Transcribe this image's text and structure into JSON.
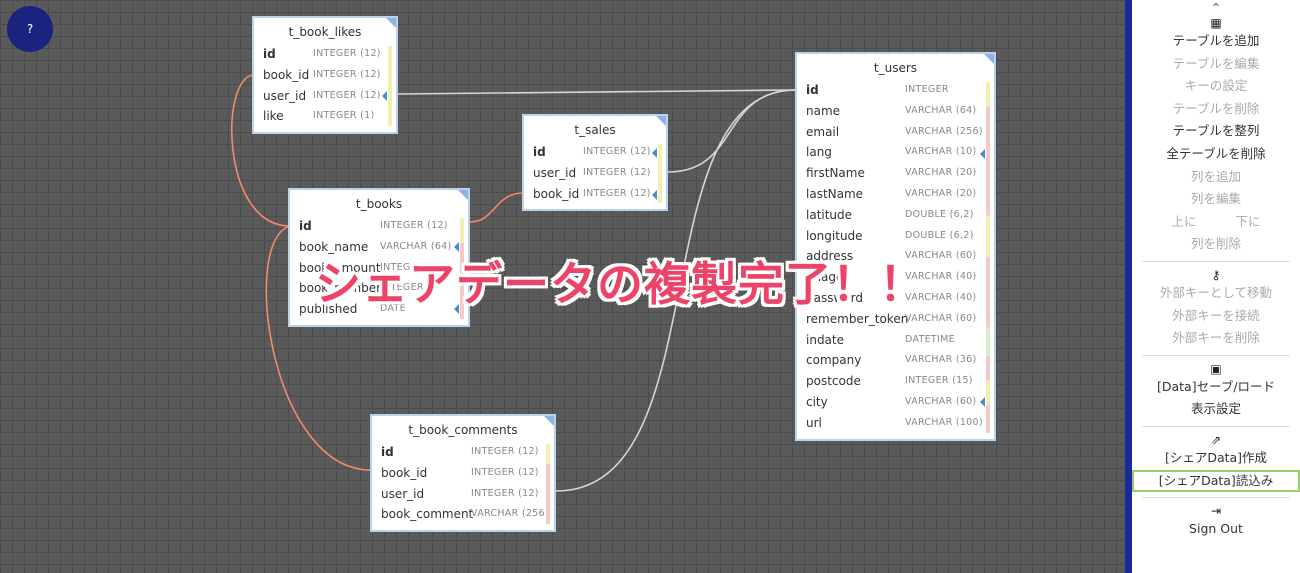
{
  "help": {
    "label": "?"
  },
  "overlay": {
    "text": "シェアデータの複製完了！！"
  },
  "tables": [
    {
      "name": "t_book_likes",
      "columns": [
        {
          "name": "id",
          "type": "INTEGER (12)",
          "pk": true
        },
        {
          "name": "book_id",
          "type": "INTEGER (12)"
        },
        {
          "name": "user_id",
          "type": "INTEGER (12)"
        },
        {
          "name": "like",
          "type": "INTEGER (1)"
        }
      ]
    },
    {
      "name": "t_sales",
      "columns": [
        {
          "name": "id",
          "type": "INTEGER (12)",
          "pk": true
        },
        {
          "name": "user_id",
          "type": "INTEGER (12)"
        },
        {
          "name": "book_id",
          "type": "INTEGER (12)"
        }
      ]
    },
    {
      "name": "t_books",
      "columns": [
        {
          "name": "id",
          "type": "INTEGER (12)",
          "pk": true
        },
        {
          "name": "book_name",
          "type": "VARCHAR (64)"
        },
        {
          "name": "book_amount",
          "type": "INTEGER"
        },
        {
          "name": "book_number",
          "type": "INTEGER"
        },
        {
          "name": "published",
          "type": "DATE"
        }
      ]
    },
    {
      "name": "t_book_comments",
      "columns": [
        {
          "name": "id",
          "type": "INTEGER (12)",
          "pk": true
        },
        {
          "name": "book_id",
          "type": "INTEGER (12)"
        },
        {
          "name": "user_id",
          "type": "INTEGER (12)"
        },
        {
          "name": "book_comment",
          "type": "VARCHAR (256)"
        }
      ]
    },
    {
      "name": "t_users",
      "columns": [
        {
          "name": "id",
          "type": "INTEGER",
          "pk": true
        },
        {
          "name": "name",
          "type": "VARCHAR (64)"
        },
        {
          "name": "email",
          "type": "VARCHAR (256)"
        },
        {
          "name": "lang",
          "type": "VARCHAR (10)"
        },
        {
          "name": "firstName",
          "type": "VARCHAR (20)"
        },
        {
          "name": "lastName",
          "type": "VARCHAR (20)"
        },
        {
          "name": "latitude",
          "type": "DOUBLE (6,2)"
        },
        {
          "name": "longitude",
          "type": "DOUBLE (6,2)"
        },
        {
          "name": "address",
          "type": "VARCHAR (60)"
        },
        {
          "name": "image",
          "type": "VARCHAR (40)"
        },
        {
          "name": "password",
          "type": "VARCHAR (40)"
        },
        {
          "name": "remember_token",
          "type": "VARCHAR (60)"
        },
        {
          "name": "indate",
          "type": "DATETIME"
        },
        {
          "name": "company",
          "type": "VARCHAR (36)"
        },
        {
          "name": "postcode",
          "type": "INTEGER (15)"
        },
        {
          "name": "city",
          "type": "VARCHAR (60)"
        },
        {
          "name": "url",
          "type": "VARCHAR (100)"
        }
      ]
    }
  ],
  "sidebar": {
    "chevron": "⌃",
    "table_icon": "table-icon",
    "add_table": "テーブルを追加",
    "edit_table": "テーブルを編集",
    "key_settings": "キーの設定",
    "delete_table": "テーブルを削除",
    "arrange_tables": "テーブルを整列",
    "delete_all_tables": "全テーブルを削除",
    "add_column": "列を追加",
    "edit_column": "列を編集",
    "move_up": "上に",
    "move_down": "下に",
    "delete_column": "列を削除",
    "key_icon": "key-icon",
    "move_as_fk": "外部キーとして移動",
    "connect_fk": "外部キーを接続",
    "delete_fk": "外部キーを削除",
    "save_icon": "save-icon",
    "data_save_load": "[Data]セーブ/ロード",
    "display_settings": "表示設定",
    "share_icon": "share-icon",
    "share_create": "[シェアData]作成",
    "share_load": "[シェアData]読込み",
    "signout_icon": "sign-out-icon",
    "sign_out": "Sign Out"
  }
}
